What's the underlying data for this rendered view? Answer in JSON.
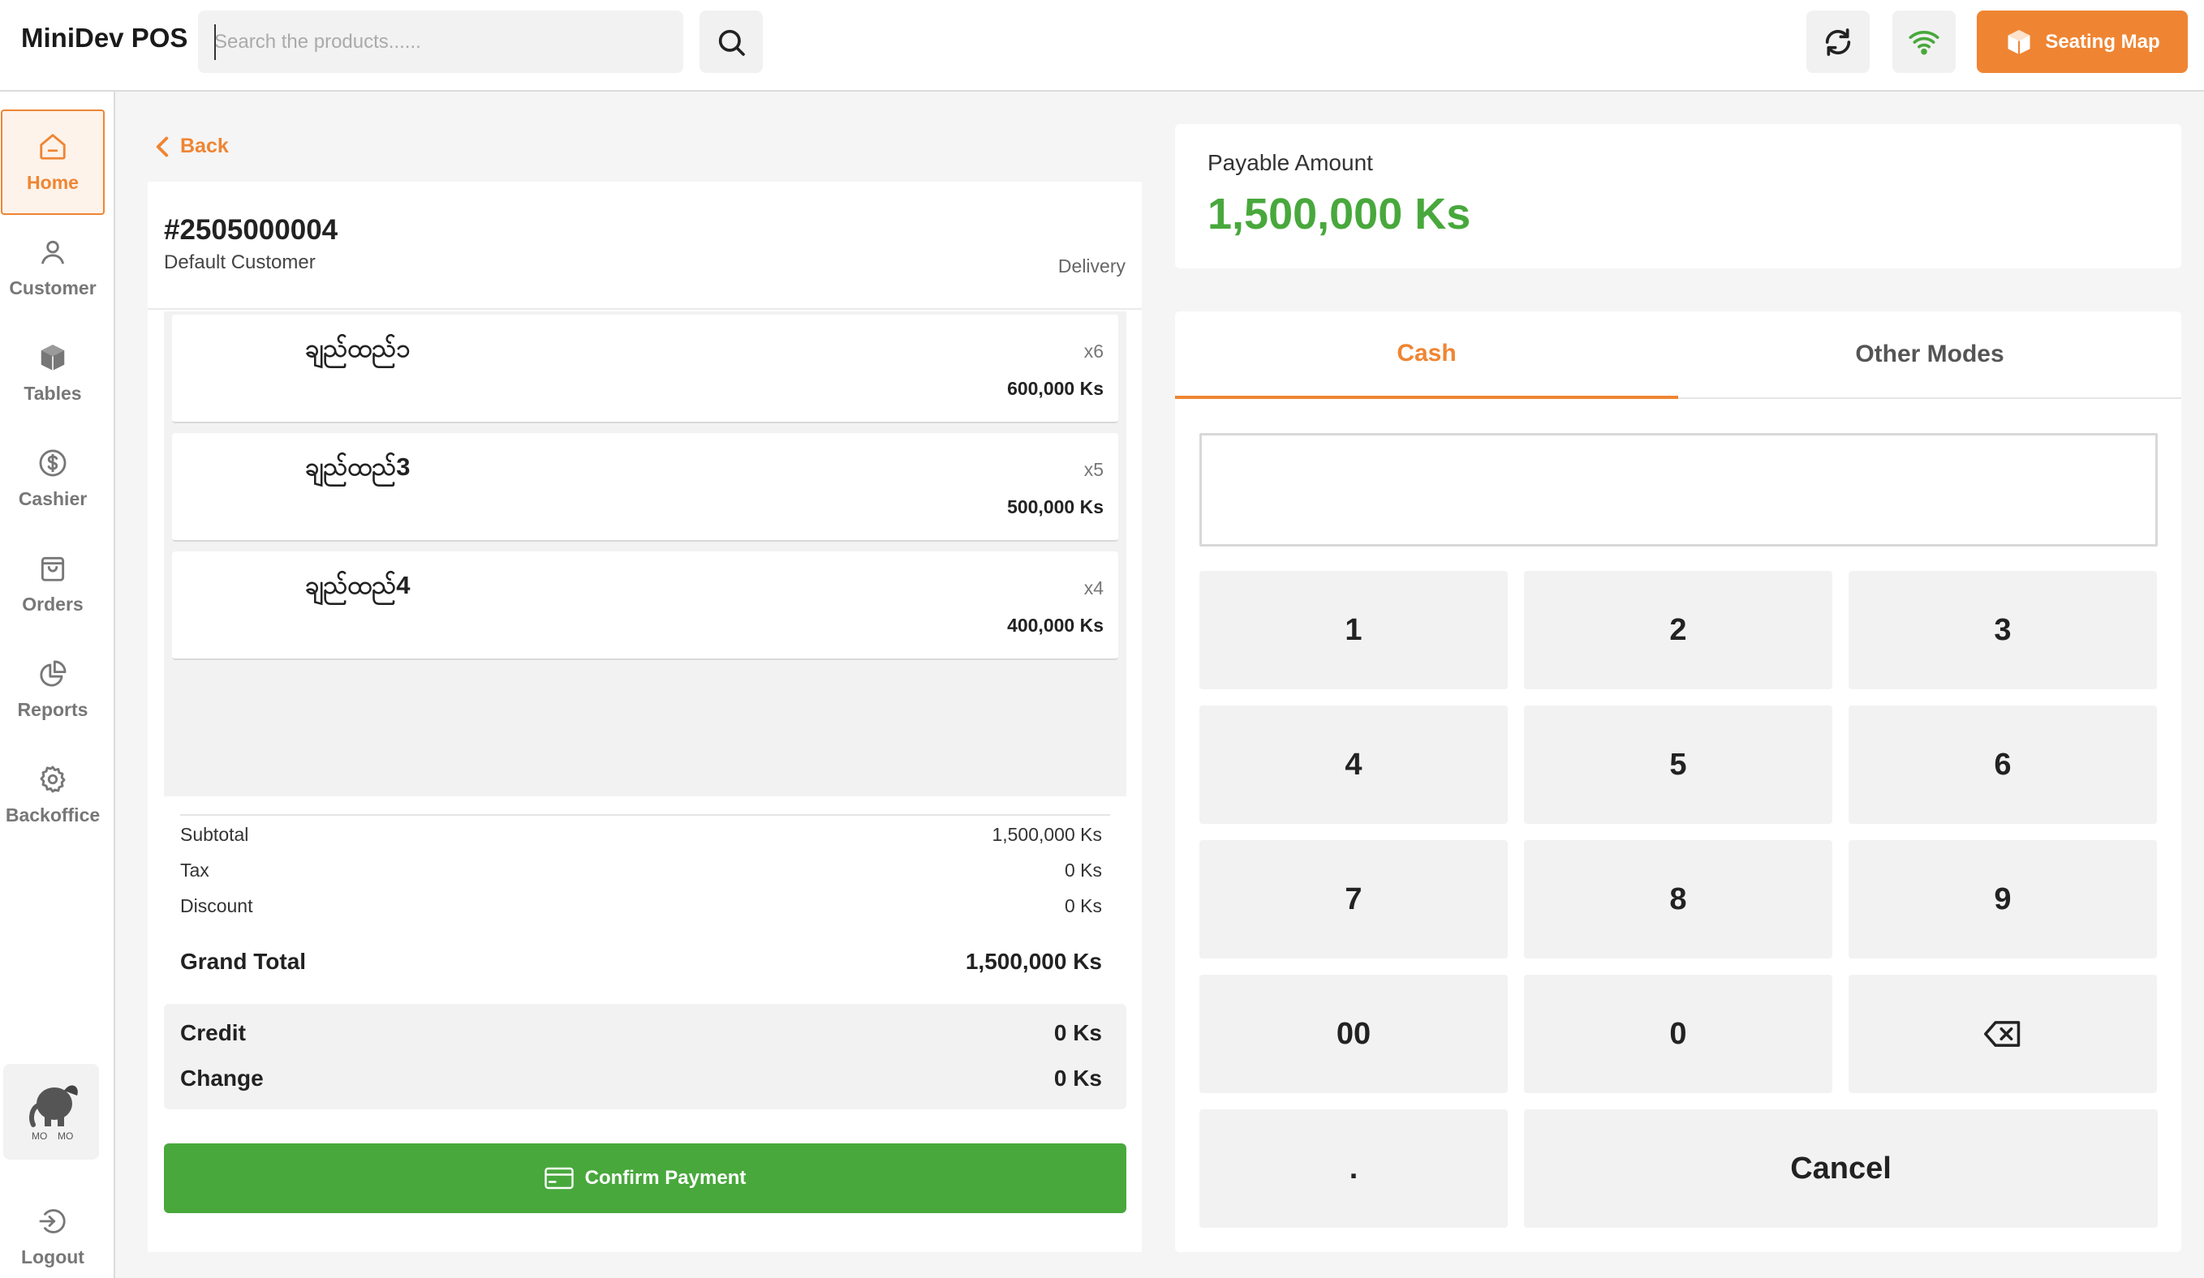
{
  "app": {
    "title": "MiniDev POS",
    "search_placeholder": "Search the products......",
    "seating_label": "Seating Map",
    "accent_color": "#ef8533",
    "success_color": "#48a83c"
  },
  "sidebar": {
    "items": [
      {
        "label": "Home",
        "icon": "home-icon",
        "active": true
      },
      {
        "label": "Customer",
        "icon": "user-icon"
      },
      {
        "label": "Tables",
        "icon": "cube-icon"
      },
      {
        "label": "Cashier",
        "icon": "dollar-icon"
      },
      {
        "label": "Orders",
        "icon": "bag-icon"
      },
      {
        "label": "Reports",
        "icon": "pie-chart-icon"
      },
      {
        "label": "Backoffice",
        "icon": "gear-icon"
      }
    ],
    "logout_label": "Logout"
  },
  "order": {
    "back_label": "Back",
    "number": "#2505000004",
    "customer": "Default Customer",
    "type": "Delivery",
    "items": [
      {
        "name": "ချည်ထည်၁",
        "qty": "x6",
        "price": "600,000 Ks"
      },
      {
        "name": "ချည်ထည်3",
        "qty": "x5",
        "price": "500,000 Ks"
      },
      {
        "name": "ချည်ထည်4",
        "qty": "x4",
        "price": "400,000 Ks"
      }
    ],
    "summary": {
      "subtotal_label": "Subtotal",
      "subtotal": "1,500,000 Ks",
      "tax_label": "Tax",
      "tax": "0 Ks",
      "discount_label": "Discount",
      "discount": "0 Ks",
      "grand_total_label": "Grand Total",
      "grand_total": "1,500,000 Ks"
    },
    "credit_label": "Credit",
    "credit": "0 Ks",
    "change_label": "Change",
    "change": "0 Ks",
    "confirm_label": "Confirm Payment"
  },
  "payment": {
    "payable_label": "Payable Amount",
    "payable_value": "1,500,000 Ks",
    "tabs": [
      "Cash",
      "Other Modes"
    ],
    "amount_value": "",
    "keys": [
      "1",
      "2",
      "3",
      "4",
      "5",
      "6",
      "7",
      "8",
      "9",
      "00",
      "0",
      ".",
      "Cancel"
    ]
  }
}
